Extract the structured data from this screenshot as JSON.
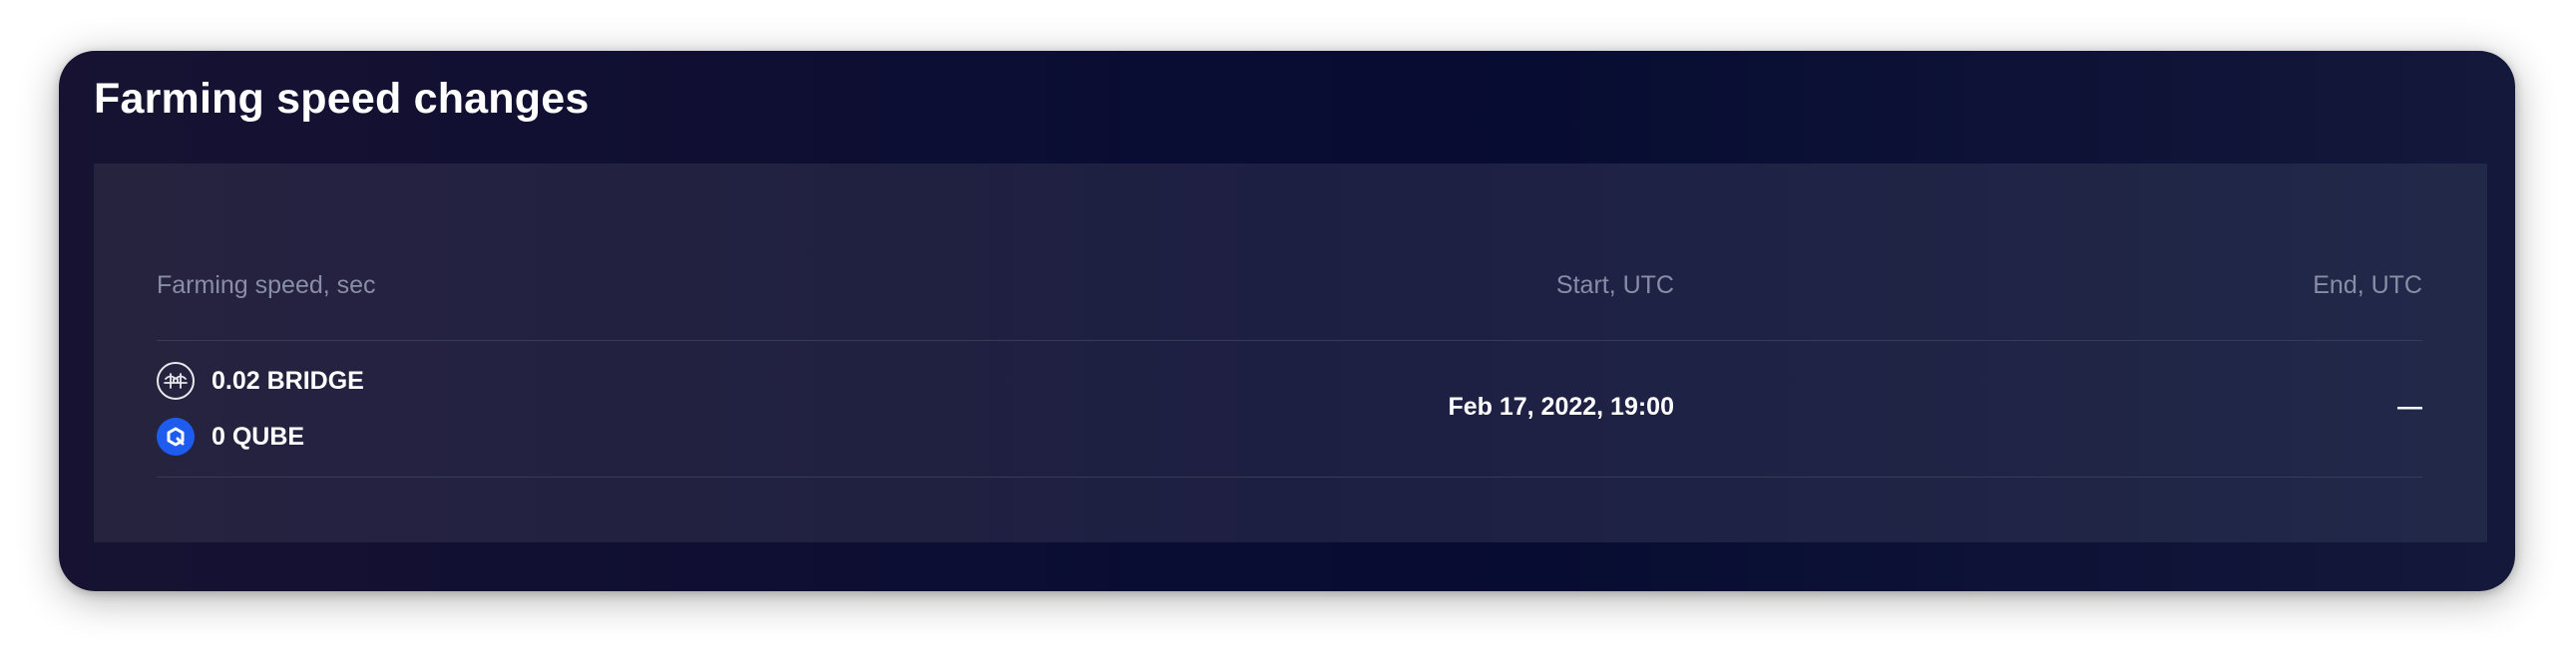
{
  "card": {
    "title": "Farming speed changes"
  },
  "table": {
    "headers": {
      "speed": "Farming speed, sec",
      "start": "Start, UTC",
      "end": "End, UTC"
    },
    "rows": [
      {
        "speeds": [
          {
            "amount": "0.02 BRIDGE",
            "icon": "bridge-token-icon"
          },
          {
            "amount": "0 QUBE",
            "icon": "qube-token-icon"
          }
        ],
        "start": "Feb 17, 2022, 19:00",
        "end": "—"
      }
    ]
  },
  "colors": {
    "card_background": "#0a0d33",
    "panel_background": "#1f2143",
    "header_text": "#8a8da6",
    "value_text": "#ffffff",
    "qube_icon": "#1e5cf0"
  }
}
